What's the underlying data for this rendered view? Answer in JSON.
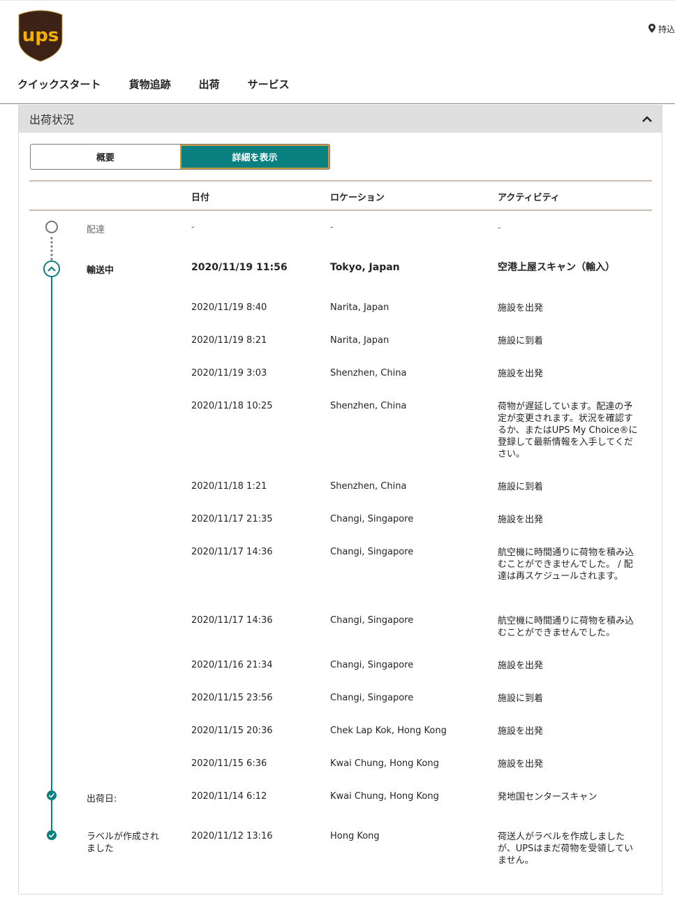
{
  "header": {
    "logo_text": "ups",
    "location_label": "持込",
    "nav": [
      "クイックスタート",
      "貨物追跡",
      "出荷",
      "サービス"
    ]
  },
  "panel": {
    "title": "出荷状況",
    "toggle": {
      "summary": "概要",
      "details": "詳細を表示"
    },
    "columns": {
      "date": "日付",
      "location": "ロケーション",
      "activity": "アクティビティ"
    }
  },
  "colors": {
    "teal": "#0a8080",
    "gold": "#c99a44",
    "brown": "#3d2316"
  },
  "events": [
    {
      "status": "配達",
      "date": "-",
      "location": "-",
      "activity": "-"
    },
    {
      "status": "輸送中",
      "date": "2020/11/19  11:56",
      "location": "Tokyo, Japan",
      "activity": "空港上屋スキャン（輸入）"
    },
    {
      "status": "",
      "date": "2020/11/19  8:40",
      "location": "Narita, Japan",
      "activity": "施設を出発"
    },
    {
      "status": "",
      "date": "2020/11/19  8:21",
      "location": "Narita, Japan",
      "activity": "施設に到着"
    },
    {
      "status": "",
      "date": "2020/11/19  3:03",
      "location": "Shenzhen, China",
      "activity": "施設を出発"
    },
    {
      "status": "",
      "date": "2020/11/18  10:25",
      "location": "Shenzhen, China",
      "activity": "荷物が遅延しています。配達の予定が変更されます。状況を確認するか、またはUPS My Choice®に登録して最新情報を入手してください。"
    },
    {
      "status": "",
      "date": "2020/11/18  1:21",
      "location": "Shenzhen, China",
      "activity": "施設に到着"
    },
    {
      "status": "",
      "date": "2020/11/17  21:35",
      "location": "Changi, Singapore",
      "activity": "施設を出発"
    },
    {
      "status": "",
      "date": "2020/11/17  14:36",
      "location": "Changi, Singapore",
      "activity": "航空機に時間通りに荷物を積み込むことができませんでした。 / 配達は再スケジュールされます。"
    },
    {
      "status": "",
      "date": "2020/11/17  14:36",
      "location": "Changi, Singapore",
      "activity": "航空機に時間通りに荷物を積み込むことができませんでした。"
    },
    {
      "status": "",
      "date": "2020/11/16  21:34",
      "location": "Changi, Singapore",
      "activity": "施設を出発"
    },
    {
      "status": "",
      "date": "2020/11/15  23:56",
      "location": "Changi, Singapore",
      "activity": "施設に到着"
    },
    {
      "status": "",
      "date": "2020/11/15  20:36",
      "location": "Chek Lap Kok, Hong Kong",
      "activity": "施設を出発"
    },
    {
      "status": "",
      "date": "2020/11/15  6:36",
      "location": "Kwai Chung, Hong Kong",
      "activity": "施設を出発"
    },
    {
      "status": "出荷日:",
      "date": "2020/11/14  6:12",
      "location": "Kwai Chung, Hong Kong",
      "activity": "発地国センタースキャン"
    },
    {
      "status": "ラベルが作成されました",
      "date": "2020/11/12  13:16",
      "location": "Hong Kong",
      "activity": "荷送人がラベルを作成しましたが、UPSはまだ荷物を受領していません。"
    }
  ]
}
